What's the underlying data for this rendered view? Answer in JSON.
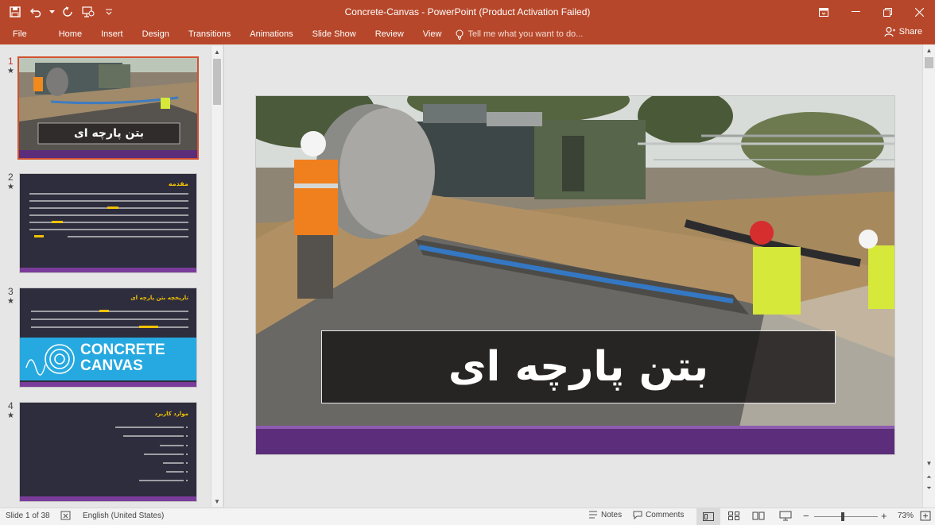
{
  "window": {
    "title": "Concrete-Canvas - PowerPoint (Product Activation Failed)"
  },
  "qat_icons": [
    "save-icon",
    "undo-icon",
    "redo-icon",
    "present-from-start-icon",
    "customize-qat-icon"
  ],
  "ribbon": {
    "tabs": [
      "File",
      "Home",
      "Insert",
      "Design",
      "Transitions",
      "Animations",
      "Slide Show",
      "Review",
      "View"
    ],
    "tell_me": "Tell me what you want to do...",
    "share": "Share"
  },
  "thumbnails": [
    {
      "num": "1",
      "title": "بتن پارچه ای"
    },
    {
      "num": "2",
      "heading": "مقدمه"
    },
    {
      "num": "3",
      "heading": "تاریخچه بتن پارچه ای",
      "logo_line1": "CONCRETE",
      "logo_line2": "CANVAS"
    },
    {
      "num": "4",
      "heading": "موارد کاربرد"
    }
  ],
  "slide": {
    "title": "بتن پارچه ای"
  },
  "status": {
    "slide_info": "Slide 1 of 38",
    "language": "English (United States)",
    "notes": "Notes",
    "comments": "Comments",
    "zoom": "73%",
    "zoom_fraction": 0.73
  },
  "colors": {
    "accent": "#b7472a",
    "slide_purple": "#5b2d7a",
    "dark_slide": "#2e2d3d",
    "highlight_yellow": "#f2c200",
    "canvas_blue": "#26a9e0"
  }
}
